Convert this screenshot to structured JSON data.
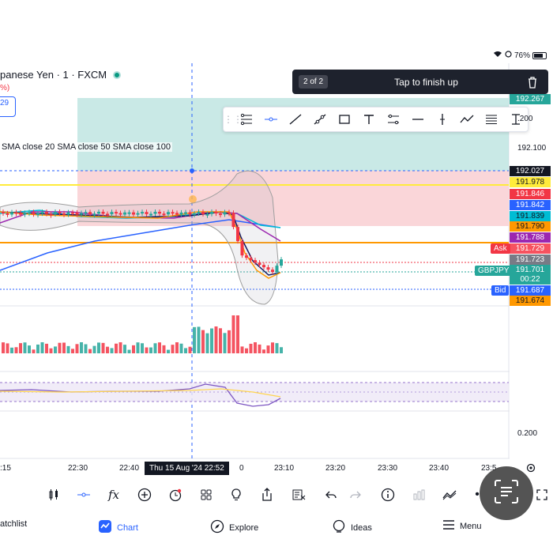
{
  "status_bar": {
    "battery": "76%"
  },
  "chart_header": {
    "symbol_title": "panese Yen · 1 · FXCM",
    "change_text": "%)",
    "mini_box_value": "29",
    "sma_legend": "SMA close 20  SMA close 50  SMA close 100"
  },
  "drawing_banner": {
    "count": "2 of 2",
    "text": "Tap to finish up"
  },
  "drawing_toolbar": {
    "tools": [
      "drag-handle-icon",
      "trend-line-icon",
      "horizontal-ray-icon",
      "ray-icon",
      "extended-line-icon",
      "rectangle-icon",
      "text-icon",
      "parallel-channel-icon",
      "horizontal-segment-icon",
      "vertical-line-icon",
      "path-icon",
      "fib-retracement-icon",
      "pitchfork-icon"
    ]
  },
  "price_axis": {
    "plain_labels": [
      {
        "text": ".200"
      },
      {
        "text": "192.100"
      },
      {
        "text": "0.200"
      }
    ],
    "tags": [
      {
        "text": "192.267",
        "color": "#26a69a",
        "text_color": "#ffffff"
      },
      {
        "text": "192.027",
        "color": "#131722",
        "text_color": "#ffffff"
      },
      {
        "text": "191.978",
        "color": "#ffeb3b",
        "text_color": "#131722"
      },
      {
        "text": "191.846",
        "color": "#f23645",
        "text_color": "#ffffff"
      },
      {
        "text": "191.842",
        "color": "#2962ff",
        "text_color": "#ffffff"
      },
      {
        "text": "191.839",
        "color": "#00bcd4",
        "text_color": "#131722"
      },
      {
        "text": "191.790",
        "color": "#ff9800",
        "text_color": "#131722"
      },
      {
        "text": "191.788",
        "color": "#9c27b0",
        "text_color": "#ffffff"
      },
      {
        "text": "191.729",
        "color": "#f7525f",
        "text_color": "#ffffff"
      },
      {
        "text": "191.723",
        "color": "#787b86",
        "text_color": "#ffffff"
      },
      {
        "text": "191.701",
        "color": "#26a69a",
        "text_color": "#ffffff"
      },
      {
        "text": "00:22",
        "color": "#26a69a",
        "text_color": "#ffffff"
      },
      {
        "text": "191.687",
        "color": "#2962ff",
        "text_color": "#ffffff"
      },
      {
        "text": "191.674",
        "color": "#ff9800",
        "text_color": "#131722"
      }
    ],
    "side_labels": {
      "ask": "Ask",
      "symbol": "GBPJPY",
      "bid": "Bid"
    }
  },
  "time_axis": {
    "labels": [
      ":15",
      "22:30",
      "22:40",
      "0",
      "23:10",
      "23:20",
      "23:30",
      "23:40",
      "23:5"
    ],
    "crosshair": "Thu 15 Aug '24  22:52"
  },
  "bottom_toolbar": {
    "icons": [
      "candles-icon",
      "crosshair-icon",
      "indicators-icon",
      "add-icon",
      "alert-icon",
      "layouts-icon",
      "ideas-bulb-icon",
      "share-icon",
      "trading-panel-icon",
      "undo-icon",
      "redo-icon",
      "info-icon",
      "data-window-icon",
      "compare-icon",
      "more-icon",
      "fullscreen-icon"
    ]
  },
  "nav": {
    "watchlist": "atchlist",
    "chart": "Chart",
    "explore": "Explore",
    "ideas": "Ideas",
    "menu": "Menu"
  },
  "colors": {
    "accent": "#2962ff",
    "up": "#26a69a",
    "down": "#f23645",
    "target_zone": "#b2dfdb",
    "stop_zone": "#f8c8cc"
  }
}
